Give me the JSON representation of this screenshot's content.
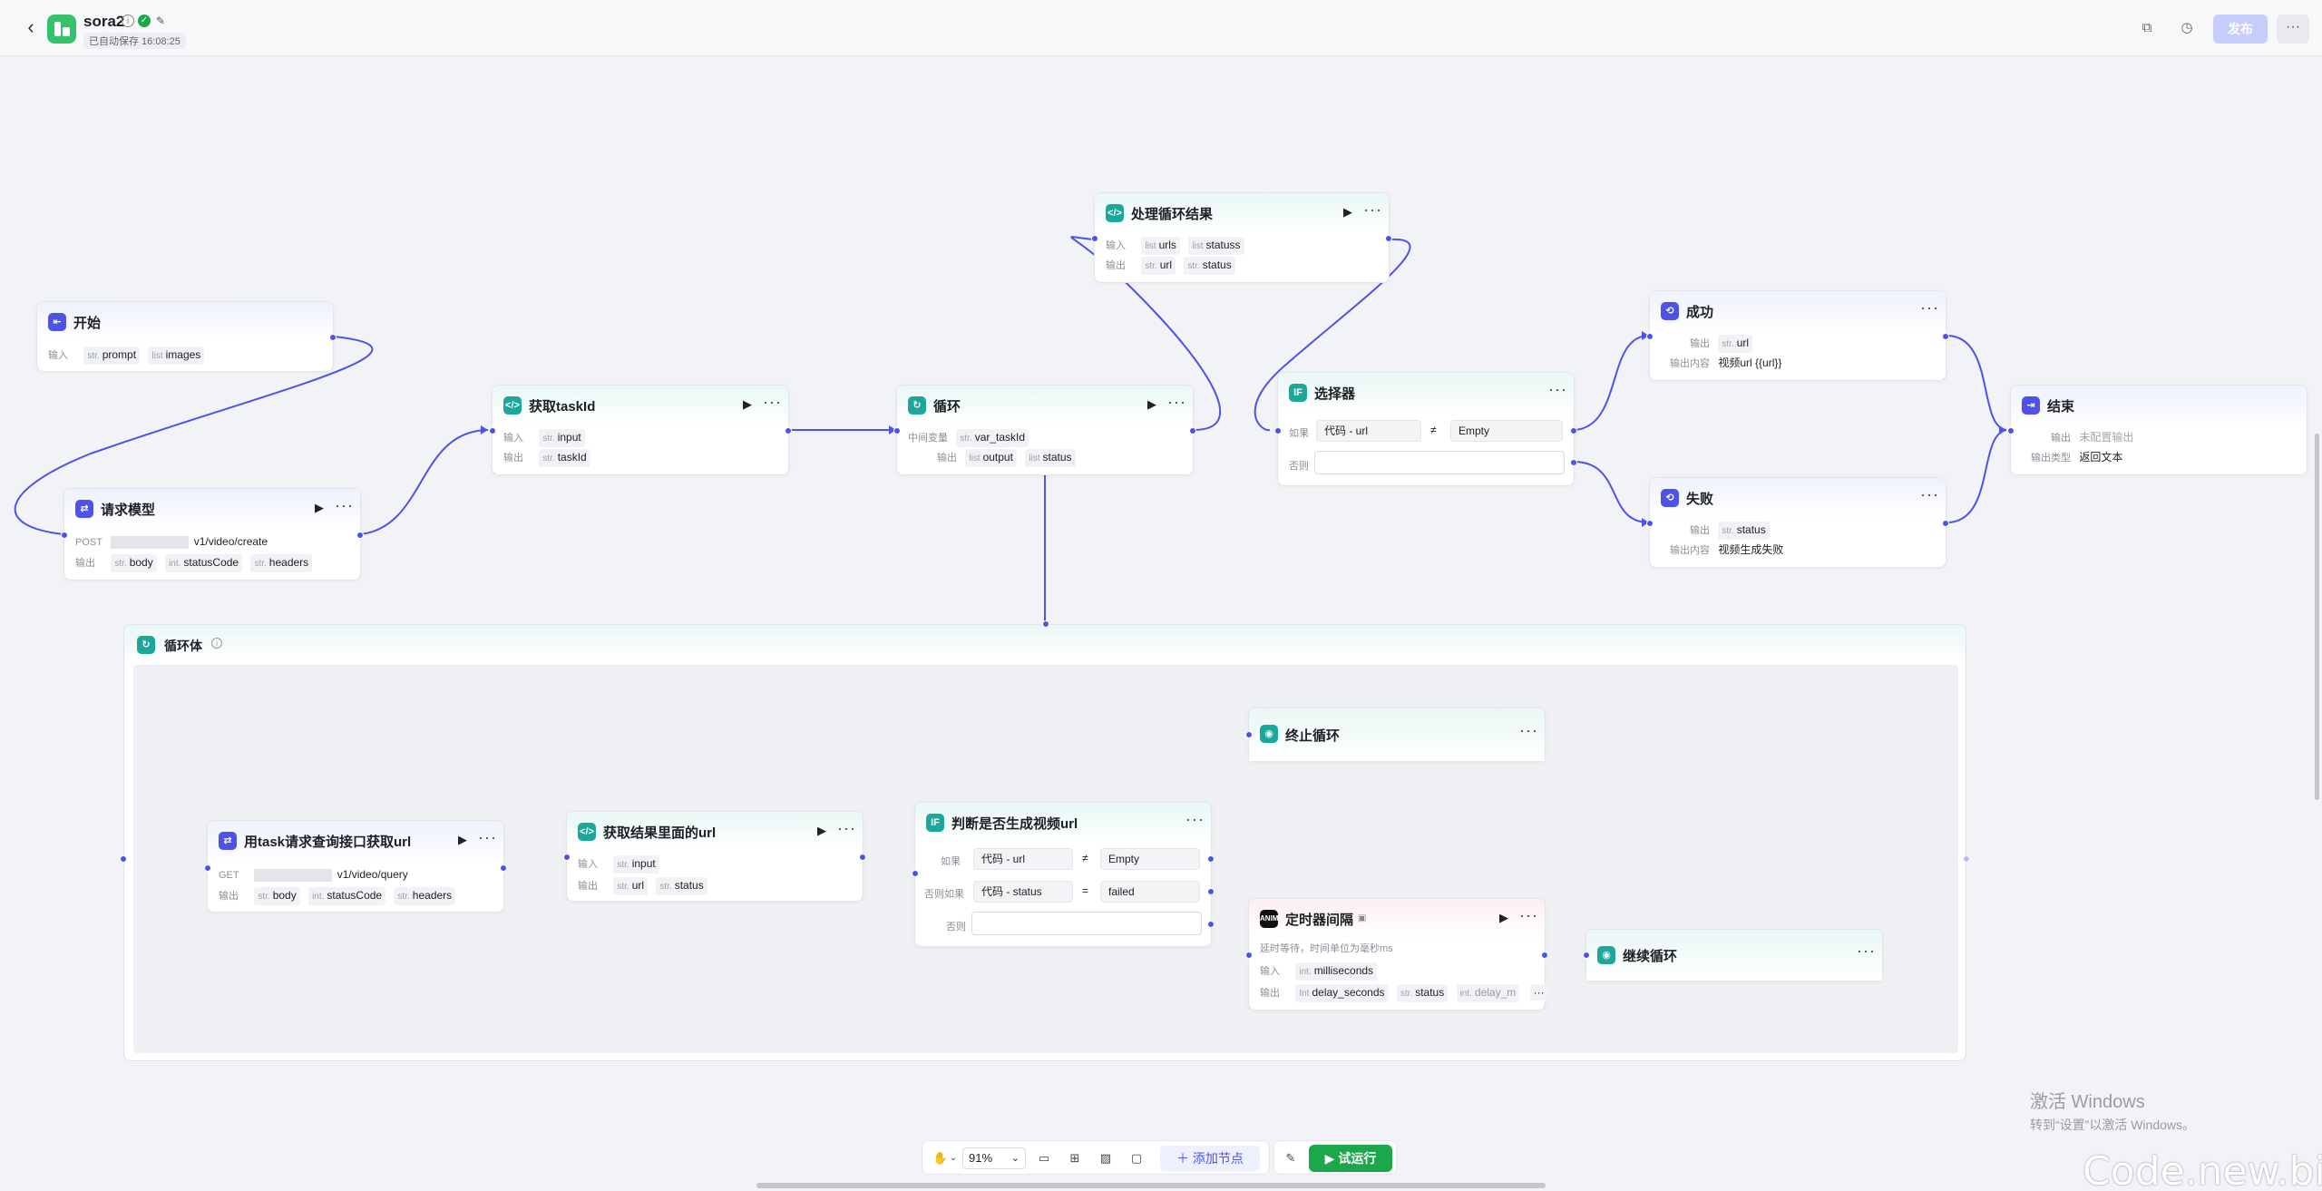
{
  "header": {
    "title": "sora2",
    "save_status": "已自动保存 16:08:25",
    "publish_label": "发布",
    "more_label": "···"
  },
  "colors": {
    "accent": "#4d53e8",
    "teal": "#1ba79a",
    "run": "#1aa84a"
  },
  "nodes": {
    "start": {
      "title": "开始",
      "input_label": "输入",
      "chip1_type": "str.",
      "chip1": "prompt",
      "chip2_type": "list",
      "chip2": "images"
    },
    "request": {
      "title": "请求模型",
      "method": "POST",
      "url": "v1/video/create",
      "output_label": "输出",
      "chip1_type": "str.",
      "chip1": "body",
      "chip2_type": "int.",
      "chip2": "statusCode",
      "chip3_type": "str.",
      "chip3": "headers"
    },
    "get_task": {
      "title": "获取taskId",
      "input_label": "输入",
      "output_label": "输出",
      "in_type": "str.",
      "in": "input",
      "out_type": "str.",
      "out": "taskId"
    },
    "loop": {
      "title": "循环",
      "mid_label": "中间变量",
      "out_label": "输出",
      "mid_type": "str.",
      "mid": "var_taskId",
      "o1_type": "list",
      "o1": "output",
      "o2_type": "list",
      "o2": "status"
    },
    "process": {
      "title": "处理循环结果",
      "input_label": "输入",
      "output_label": "输出",
      "i1_type": "list",
      "i1": "urls",
      "i2_type": "list",
      "i2": "statuss",
      "o1_type": "str.",
      "o1": "url",
      "o2_type": "str.",
      "o2": "status"
    },
    "selector": {
      "title": "选择器",
      "if_label": "如果",
      "else_label": "否则",
      "cond_left": "代码 - url",
      "cond_op": "≠",
      "cond_right": "Empty"
    },
    "success": {
      "title": "成功",
      "out_label": "输出",
      "content_label": "输出内容",
      "chip_type": "str.",
      "chip": "url",
      "content": "视频url {{url}}"
    },
    "fail": {
      "title": "失败",
      "out_label": "输出",
      "content_label": "输出内容",
      "chip_type": "str.",
      "chip": "status",
      "content": "视频生成失败"
    },
    "end": {
      "title": "结束",
      "out_label": "输出",
      "type_label": "输出类型",
      "out_value": "未配置输出",
      "type_value": "返回文本"
    },
    "loop_body": {
      "title": "循环体"
    },
    "query": {
      "title": "用task请求查询接口获取url",
      "method": "GET",
      "url": "v1/video/query",
      "output_label": "输出",
      "chip1_type": "str.",
      "chip1": "body",
      "chip2_type": "int.",
      "chip2": "statusCode",
      "chip3_type": "str.",
      "chip3": "headers"
    },
    "get_url": {
      "title": "获取结果里面的url",
      "input_label": "输入",
      "output_label": "输出",
      "in_type": "str.",
      "in": "input",
      "o1_type": "str.",
      "o1": "url",
      "o2_type": "str.",
      "o2": "status"
    },
    "judge": {
      "title": "判断是否生成视频url",
      "if_label": "如果",
      "elif_label": "否则如果",
      "else_label": "否则",
      "c1_left": "代码 - url",
      "c1_op": "≠",
      "c1_right": "Empty",
      "c2_left": "代码 - status",
      "c2_op": "=",
      "c2_right": "failed"
    },
    "stop": {
      "title": "终止循环"
    },
    "timer": {
      "title": "定时器间隔",
      "desc": "延时等待，时间单位为毫秒ms",
      "input_label": "输入",
      "output_label": "输出",
      "in_type": "int.",
      "in": "milliseconds",
      "o1_type": "Int",
      "o1": "delay_seconds",
      "o2_type": "str.",
      "o2": "status",
      "o3_type": "int.",
      "o3": "delay_m"
    },
    "continue": {
      "title": "继续循环"
    }
  },
  "bottom_toolbar": {
    "zoom": "91%",
    "add_node": "＋ 添加节点",
    "run": "▶ 试运行"
  },
  "watermark": {
    "line1": "激活 Windows",
    "line2": "转到“设置”以激活 Windows。",
    "code": "Code.new.bi"
  }
}
